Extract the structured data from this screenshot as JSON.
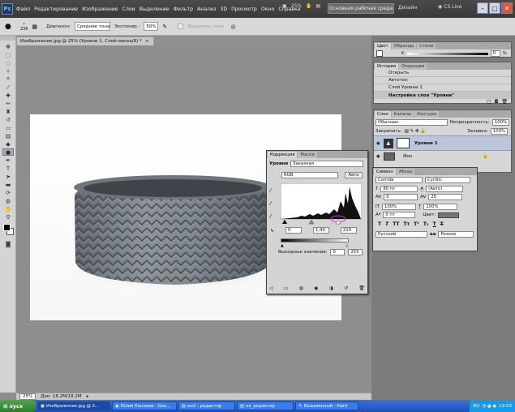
{
  "app": {
    "logo": "Ps",
    "workspace": "Основная рабочая среда",
    "design": "Дизайн",
    "cslive": "CS Live"
  },
  "menu": [
    "Файл",
    "Редактирование",
    "Изображение",
    "Слои",
    "Выделение",
    "Фильтр",
    "Анализ",
    "3D",
    "Просмотр",
    "Окно",
    "Справка"
  ],
  "menu_zoom": "25%",
  "options": {
    "brush_size": "236",
    "range_label": "Диапазон:",
    "range_value": "Средние тона",
    "exposure_label": "Экспонир.:",
    "exposure_value": "50%",
    "protect": "Защитить тона"
  },
  "document": {
    "tab": "Изображение.jpg @ 25% (Уровни 1, Слой-маска/8) *",
    "zoom": "25%",
    "doc_info": "Док: 18,2M/18,2M"
  },
  "color_panel": {
    "tabs": [
      "Цвет",
      "Образцы",
      "Стили"
    ],
    "channel": "K",
    "value": "0",
    "unit": "%"
  },
  "history_panel": {
    "tabs": [
      "История",
      "Операции"
    ],
    "items": [
      "Открыть",
      "Автотон",
      "Слой Уровни 1",
      "Настройка слоя \"Уровни\""
    ]
  },
  "layers_panel": {
    "tabs": [
      "Слои",
      "Каналы",
      "Контуры"
    ],
    "blend": "Обычные",
    "opacity_label": "Непрозрачность:",
    "opacity": "100%",
    "lock_label": "Закрепить:",
    "fill_label": "Заливка:",
    "fill": "100%",
    "layers": [
      {
        "name": "Уровни 1"
      },
      {
        "name": "Фон"
      }
    ]
  },
  "char_panel": {
    "tabs": [
      "Символ",
      "Абзац"
    ],
    "font": "Corrida",
    "style": "Cyrillic",
    "size": "80 пт",
    "leading": "(Авто)",
    "kerning": "0",
    "tracking": "25",
    "vscale": "100%",
    "hscale": "100%",
    "baseline": "0 пт",
    "color_label": "Цвет:",
    "styles": [
      "T",
      "T",
      "TT",
      "Tт",
      "T¹",
      "T₁",
      "T",
      "T"
    ],
    "language": "Русский",
    "aa": "aa",
    "aa_mode": "Резкое"
  },
  "adjustments": {
    "tabs": [
      "Коррекция",
      "Маски"
    ],
    "title": "Уровни",
    "preset": "Заказная",
    "channel": "RGB",
    "auto": "Авто",
    "input": [
      "0",
      "1,40",
      "219"
    ],
    "output_label": "Выходные значения:",
    "output": [
      "0",
      "255"
    ]
  },
  "taskbar": {
    "start": "пуск",
    "items": [
      "Изображение.jpg @ 2...",
      "Юлия Коняева - Goo...",
      "ws2 - редактор",
      "нк_редактор",
      "Безымянный - Paint"
    ],
    "lang": "RU",
    "time": "13:53"
  },
  "colors": {
    "menubar": "#3f3f3f",
    "workspace_bg": "#8f8f8f",
    "panel": "#d6d6d6",
    "taskbar": "#245edb",
    "start": "#3c9a38",
    "highlight_circle": "#cc33cc"
  }
}
